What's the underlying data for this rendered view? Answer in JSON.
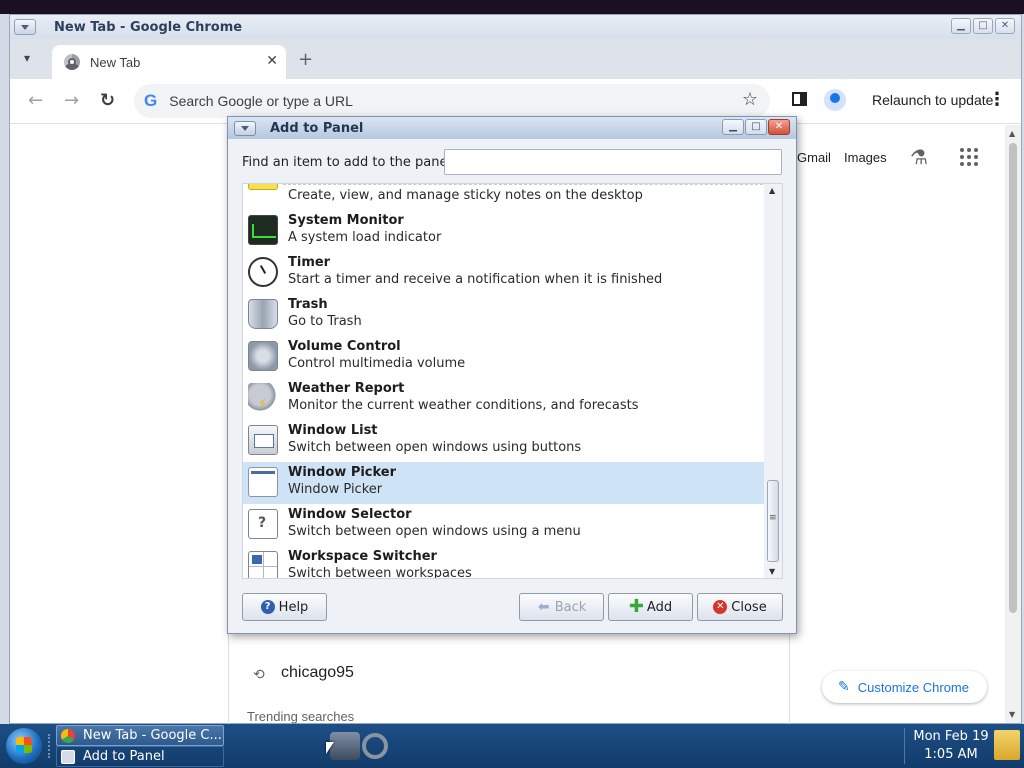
{
  "chrome": {
    "window_title": "New Tab - Google Chrome",
    "tab_title": "New Tab",
    "tab_close": "✕",
    "new_tab": "+",
    "omnibox_placeholder": "Search Google or type a URL",
    "relaunch_label": "Relaunch to update",
    "gmail": "Gmail",
    "images": "Images",
    "history_item": "chicago95",
    "trending_label": "Trending searches",
    "customize_label": "Customize Chrome"
  },
  "dialog": {
    "title": "Add to Panel",
    "find_label": "Find an item to add to the panel:",
    "find_value": "",
    "items": [
      {
        "name": "",
        "desc": "Create, view, and manage sticky notes on the desktop",
        "icon": "sticky-notes-icon",
        "selected": false
      },
      {
        "name": "System Monitor",
        "desc": "A system load indicator",
        "icon": "system-monitor-icon",
        "selected": false
      },
      {
        "name": "Timer",
        "desc": "Start a timer and receive a notification when it is finished",
        "icon": "timer-icon",
        "selected": false
      },
      {
        "name": "Trash",
        "desc": "Go to Trash",
        "icon": "trash-icon",
        "selected": false
      },
      {
        "name": "Volume Control",
        "desc": "Control multimedia volume",
        "icon": "volume-control-icon",
        "selected": false
      },
      {
        "name": "Weather Report",
        "desc": "Monitor the current weather conditions, and forecasts",
        "icon": "weather-report-icon",
        "selected": false
      },
      {
        "name": "Window List",
        "desc": "Switch between open windows using buttons",
        "icon": "window-list-icon",
        "selected": false
      },
      {
        "name": "Window Picker",
        "desc": "Window Picker",
        "icon": "window-picker-icon",
        "selected": true
      },
      {
        "name": "Window Selector",
        "desc": "Switch between open windows using a menu",
        "icon": "window-selector-icon",
        "selected": false
      },
      {
        "name": "Workspace Switcher",
        "desc": "Switch between workspaces",
        "icon": "workspace-switcher-icon",
        "selected": false
      }
    ],
    "buttons": {
      "help": "Help",
      "back": "Back",
      "add": "Add",
      "close": "Close"
    }
  },
  "taskbar": {
    "tasks": [
      "New Tab - Google C...",
      "Add to Panel"
    ],
    "clock_date": "Mon Feb 19",
    "clock_time": "1:05 AM"
  },
  "colors": {
    "selection": "#cfe3f6",
    "taskbar": "#1d4f86",
    "accent": "#1a73e8"
  }
}
